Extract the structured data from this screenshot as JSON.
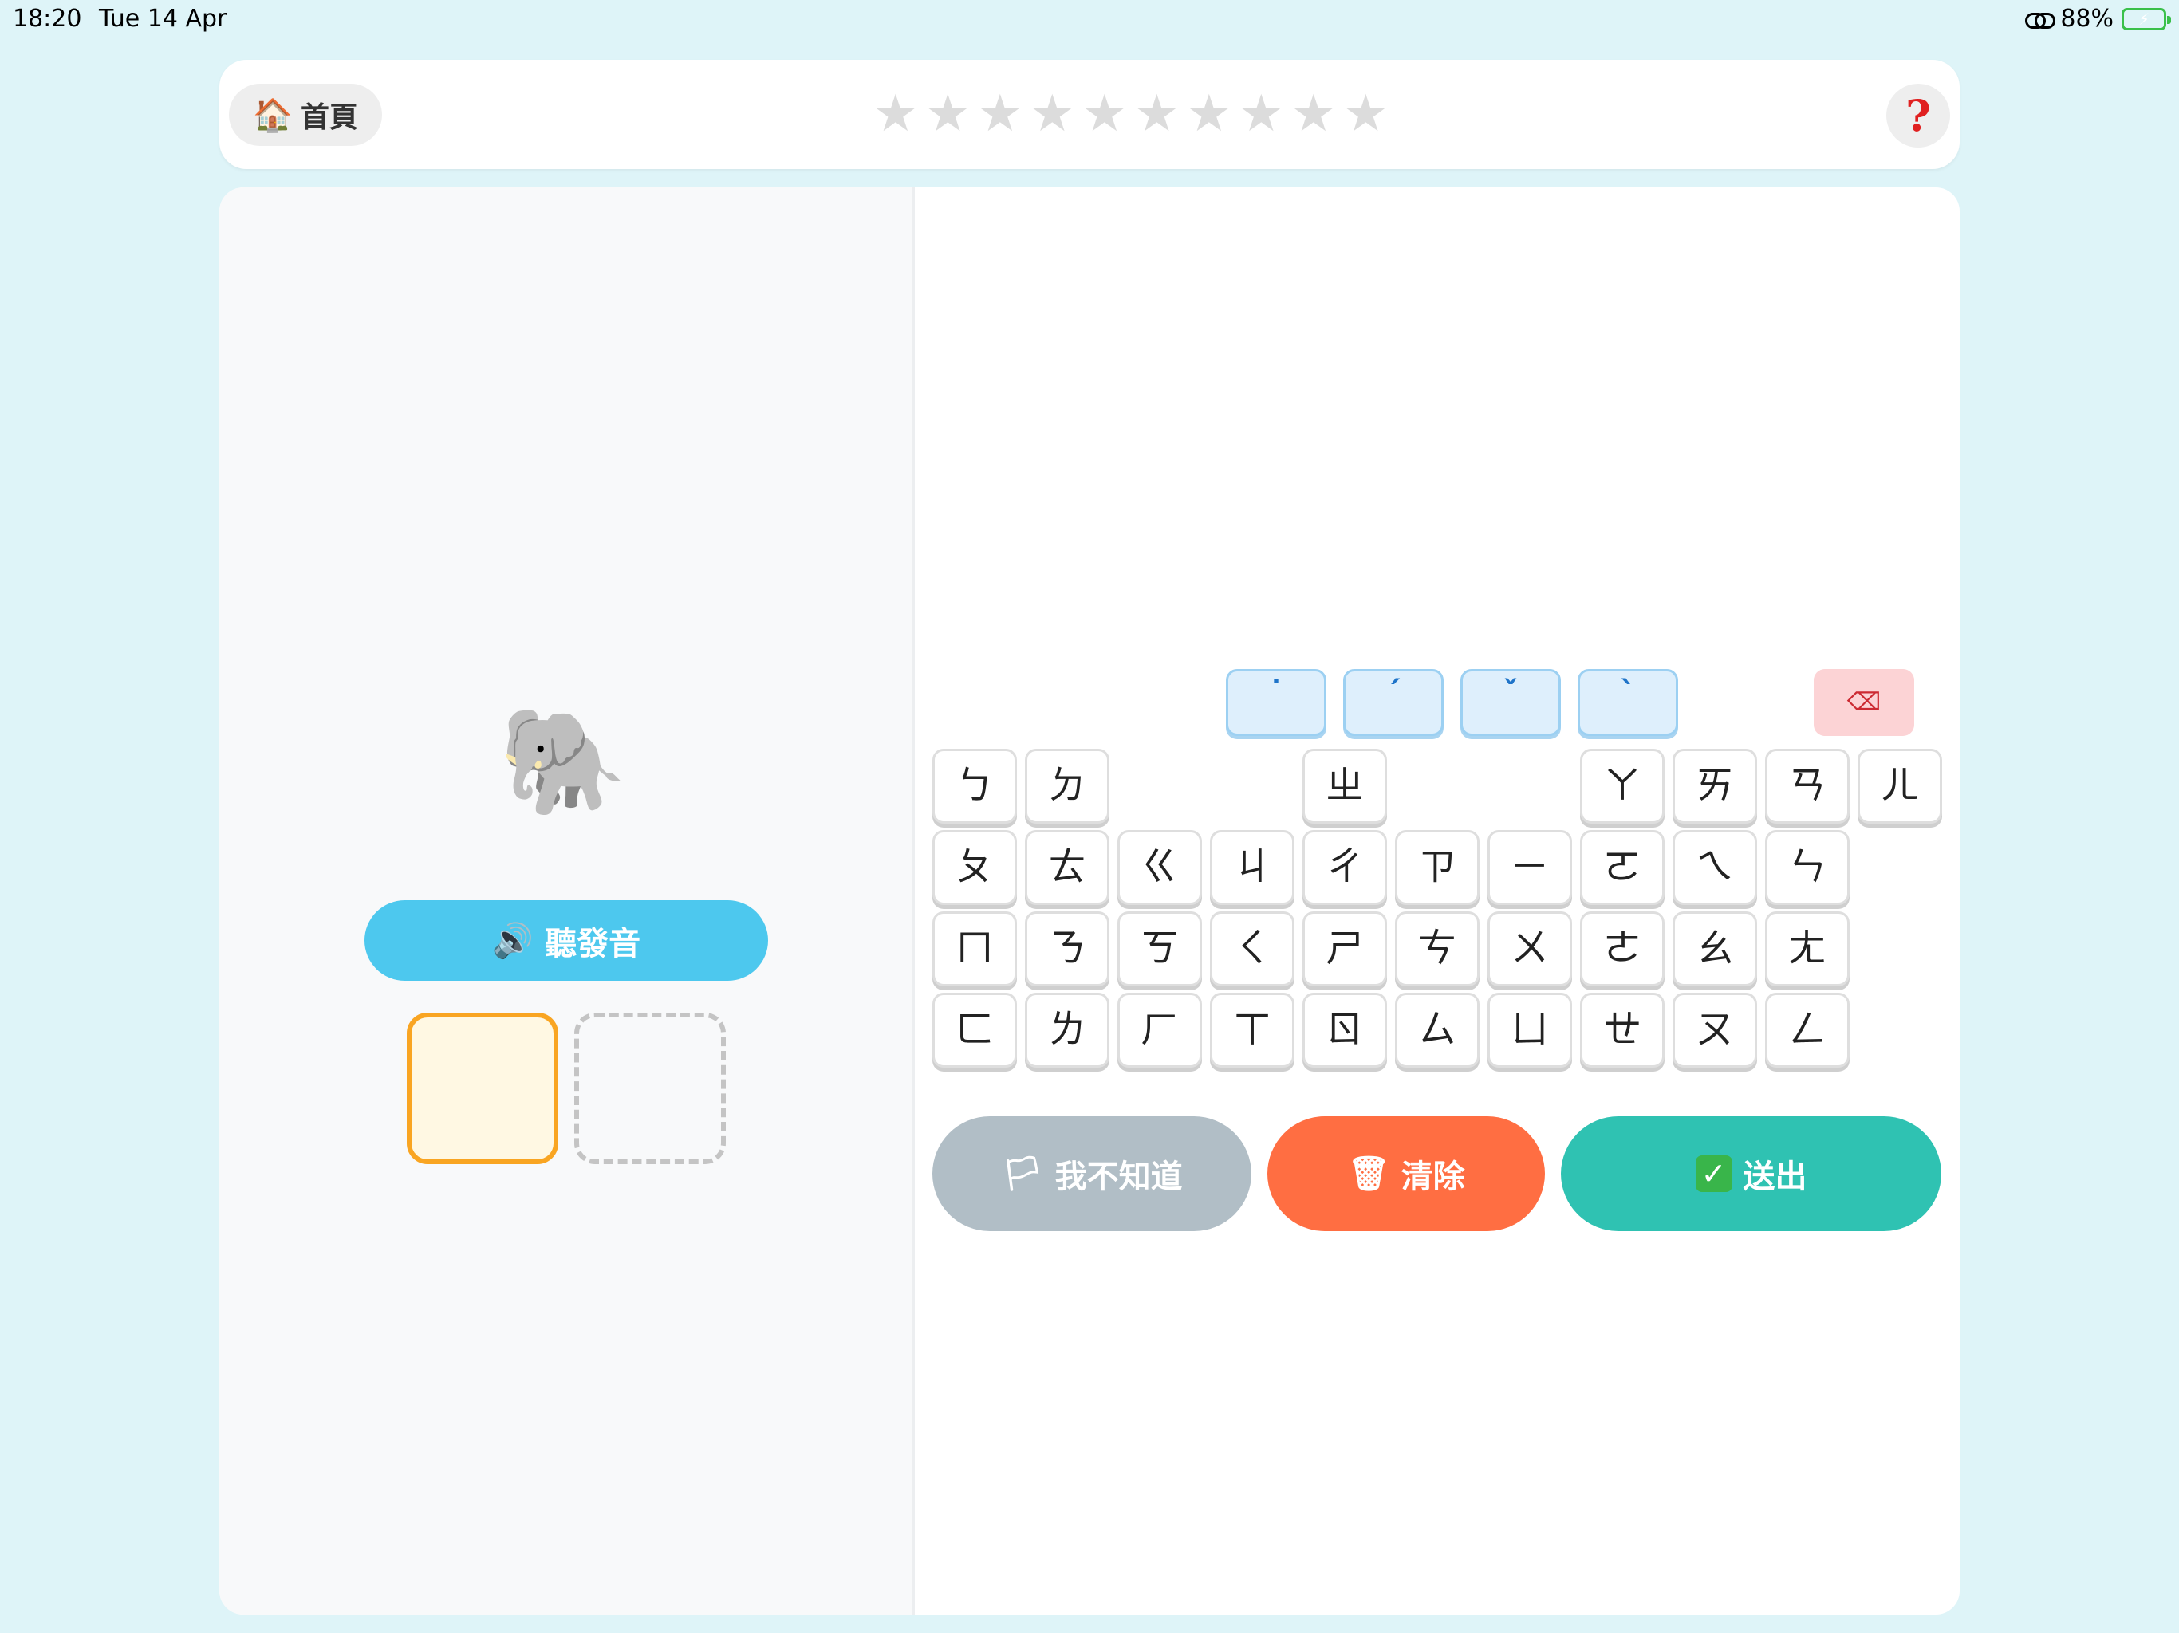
{
  "status_bar": {
    "time": "18:20",
    "date": "Tue 14 Apr",
    "battery": "88%"
  },
  "header": {
    "home_icon": "🏠",
    "home_label": "首頁",
    "stars": [
      "★",
      "★",
      "★",
      "★",
      "★",
      "★",
      "★",
      "★",
      "★",
      "★"
    ],
    "stars_earned": 0,
    "help_label": "?"
  },
  "prompt": {
    "picture_emoji": "🐘",
    "listen_icon": "🔊",
    "listen_label": "聽發音"
  },
  "answer_slots": {
    "count": 2,
    "active_index": 0,
    "values": [
      "",
      ""
    ]
  },
  "tones": [
    "˙",
    "ˊ",
    "ˇ",
    "ˋ"
  ],
  "backspace_icon": "⌫",
  "keyboard": {
    "row1": [
      "ㄅ",
      "ㄉ",
      "",
      "",
      "ㄓ",
      "",
      "",
      "ㄚ",
      "ㄞ",
      "ㄢ",
      "ㄦ"
    ],
    "row2": [
      "ㄆ",
      "ㄊ",
      "ㄍ",
      "ㄐ",
      "ㄔ",
      "ㄗ",
      "ㄧ",
      "ㄛ",
      "ㄟ",
      "ㄣ"
    ],
    "row3": [
      "ㄇ",
      "ㄋ",
      "ㄎ",
      "ㄑ",
      "ㄕ",
      "ㄘ",
      "ㄨ",
      "ㄜ",
      "ㄠ",
      "ㄤ"
    ],
    "row4": [
      "ㄈ",
      "ㄌ",
      "ㄏ",
      "ㄒ",
      "ㄖ",
      "ㄙ",
      "ㄩ",
      "ㄝ",
      "ㄡ",
      "ㄥ"
    ]
  },
  "actions": {
    "dontknow_icon": "🏳",
    "dontknow_label": "我不知道",
    "clear_icon": "🗑",
    "clear_label": "清除",
    "submit_icon": "✓",
    "submit_label": "送出"
  },
  "colors": {
    "background": "#def4f8",
    "listen": "#4dc8ee",
    "slot_active_border": "#f9a522",
    "dontknow": "#b1bec6",
    "clear": "#ff6e42",
    "submit": "#2fc2b2",
    "help": "#e02020"
  }
}
